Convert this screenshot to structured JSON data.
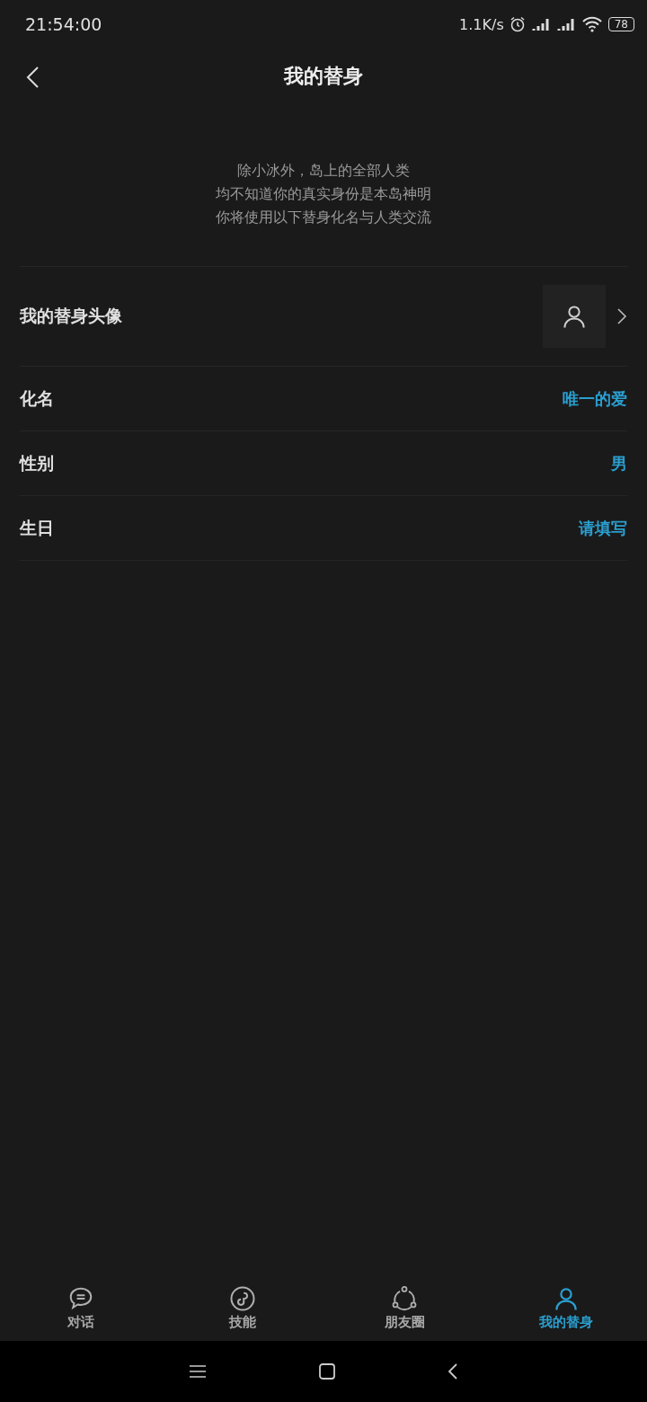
{
  "status_bar": {
    "time": "21:54:00",
    "speed": "1.1K/s",
    "battery": "78"
  },
  "header": {
    "title": "我的替身"
  },
  "intro": [
    "除小冰外，岛上的全部人类",
    "均不知道你的真实身份是本岛神明",
    "你将使用以下替身化名与人类交流"
  ],
  "rows": [
    {
      "kind": "avatar",
      "label": "我的替身头像"
    },
    {
      "kind": "value",
      "label": "化名",
      "value": "唯一的爱"
    },
    {
      "kind": "value",
      "label": "性别",
      "value": "男"
    },
    {
      "kind": "value",
      "label": "生日",
      "value": "请填写"
    }
  ],
  "tabs": [
    {
      "kind": "chat",
      "label": "对话",
      "selected": false
    },
    {
      "kind": "skill",
      "label": "技能",
      "selected": false
    },
    {
      "kind": "circle",
      "label": "朋友圈",
      "selected": false
    },
    {
      "kind": "person",
      "label": "我的替身",
      "selected": true
    }
  ]
}
